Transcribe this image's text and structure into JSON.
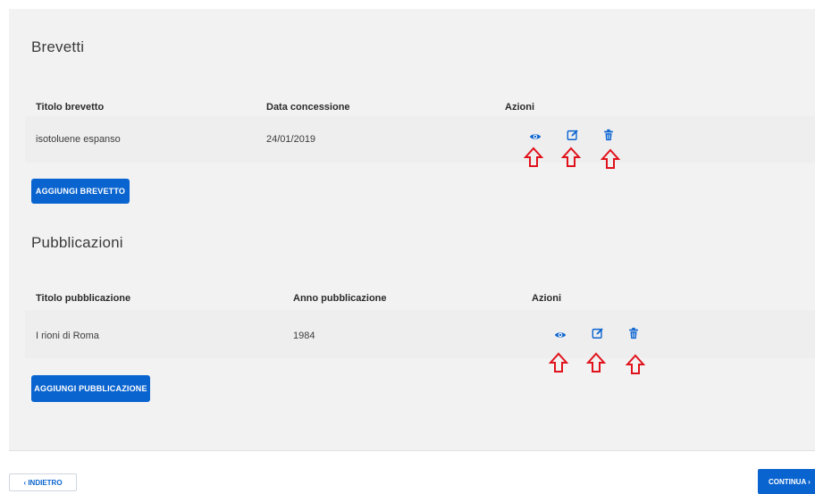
{
  "sections": {
    "brevetti": {
      "title": "Brevetti",
      "headers": [
        "Titolo brevetto",
        "Data concessione",
        "Azioni"
      ],
      "rows": [
        {
          "titolo": "isotoluene espanso",
          "data": "24/01/2019"
        }
      ],
      "add_button": "AGGIUNGI BREVETTO"
    },
    "pubblicazioni": {
      "title": "Pubblicazioni",
      "headers": [
        "Titolo pubblicazione",
        "Anno pubblicazione",
        "Azioni"
      ],
      "rows": [
        {
          "titolo": "I rioni di Roma",
          "anno": "1984"
        }
      ],
      "add_button": "AGGIUNGI PUBBLICAZIONE"
    }
  },
  "footer": {
    "back_label": "‹ INDIETRO",
    "continue_label": "CONTINUA ›"
  },
  "icons": {
    "view": "eye-icon",
    "edit": "edit-icon",
    "delete": "trash-icon",
    "annotation": "red-up-arrow"
  },
  "colors": {
    "primary": "#0a64cf",
    "annotation": "#e0121b",
    "card": "#f2f2f3"
  }
}
